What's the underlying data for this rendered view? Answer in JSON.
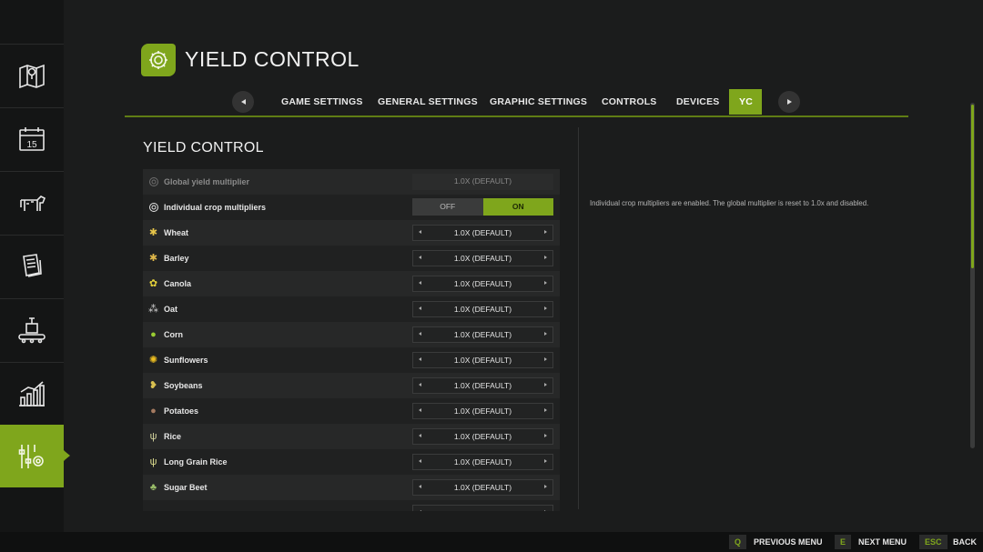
{
  "header": {
    "title": "YIELD CONTROL",
    "icon": "gear-icon"
  },
  "tabs": [
    {
      "label": "GAME SETTINGS",
      "active": false
    },
    {
      "label": "GENERAL SETTINGS",
      "active": false
    },
    {
      "label": "GRAPHIC SETTINGS",
      "active": false
    },
    {
      "label": "CONTROLS",
      "active": false
    },
    {
      "label": "DEVICES",
      "active": false
    },
    {
      "label": "YC",
      "active": true
    }
  ],
  "sidebar": [
    {
      "icon": "map-icon",
      "active": false
    },
    {
      "icon": "calendar-icon",
      "active": false,
      "label": "15"
    },
    {
      "icon": "cow-icon",
      "active": false
    },
    {
      "icon": "contracts-icon",
      "active": false
    },
    {
      "icon": "production-icon",
      "active": false
    },
    {
      "icon": "statistics-icon",
      "active": false
    },
    {
      "icon": "settings-icon",
      "active": true
    }
  ],
  "section": {
    "title": "YIELD CONTROL",
    "global": {
      "label": "Global yield multiplier",
      "value": "1.0X (DEFAULT)"
    },
    "individual": {
      "label": "Individual crop multipliers",
      "off": "OFF",
      "on": "ON",
      "selected": "ON"
    },
    "crops": [
      {
        "name": "Wheat",
        "value": "1.0X (DEFAULT)",
        "icon": "wheat-icon"
      },
      {
        "name": "Barley",
        "value": "1.0X (DEFAULT)",
        "icon": "barley-icon"
      },
      {
        "name": "Canola",
        "value": "1.0X (DEFAULT)",
        "icon": "canola-icon"
      },
      {
        "name": "Oat",
        "value": "1.0X (DEFAULT)",
        "icon": "oat-icon"
      },
      {
        "name": "Corn",
        "value": "1.0X (DEFAULT)",
        "icon": "corn-icon"
      },
      {
        "name": "Sunflowers",
        "value": "1.0X (DEFAULT)",
        "icon": "sunflower-icon"
      },
      {
        "name": "Soybeans",
        "value": "1.0X (DEFAULT)",
        "icon": "soybean-icon"
      },
      {
        "name": "Potatoes",
        "value": "1.0X (DEFAULT)",
        "icon": "potato-icon"
      },
      {
        "name": "Rice",
        "value": "1.0X (DEFAULT)",
        "icon": "rice-icon"
      },
      {
        "name": "Long Grain Rice",
        "value": "1.0X (DEFAULT)",
        "icon": "long-grain-rice-icon"
      },
      {
        "name": "Sugar Beet",
        "value": "1.0X (DEFAULT)",
        "icon": "sugar-beet-icon"
      },
      {
        "name": "",
        "value": "",
        "icon": ""
      }
    ],
    "description": "Individual crop multipliers are enabled. The global multiplier is reset to 1.0x and disabled."
  },
  "footer": [
    {
      "key": "Q",
      "label": "PREVIOUS MENU"
    },
    {
      "key": "E",
      "label": "NEXT MENU"
    },
    {
      "key": "ESC",
      "label": "BACK"
    }
  ],
  "colors": {
    "accent": "#7fa61c",
    "background": "#1b1c1c"
  }
}
